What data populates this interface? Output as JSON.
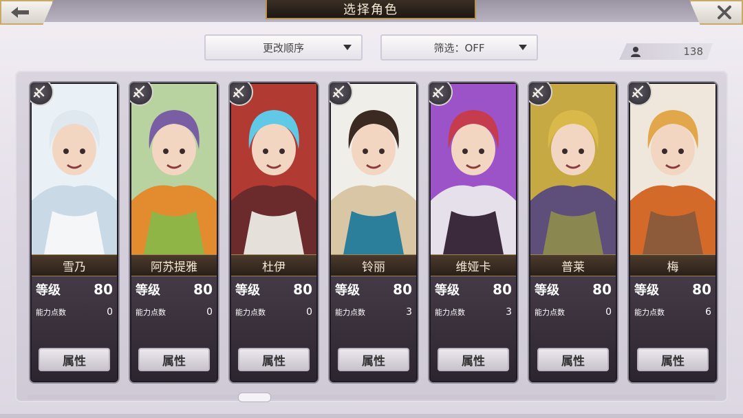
{
  "header": {
    "title": "选择角色",
    "back_icon": "back-arrow-icon",
    "close_icon": "close-icon"
  },
  "controls": {
    "sort_label": "更改顺序",
    "filter_label": "筛选：OFF",
    "roster_count": "138"
  },
  "labels": {
    "level": "等级",
    "ability_points": "能力点数",
    "attributes_button": "属性"
  },
  "characters": [
    {
      "name": "雪乃",
      "level": "80",
      "ability_points": "0",
      "colors": [
        "#e9f1f7",
        "#c9d9e6",
        "#f4f6f8"
      ],
      "hair": "#dfe7ef"
    },
    {
      "name": "阿苏提雅",
      "level": "80",
      "ability_points": "0",
      "colors": [
        "#b8d2a0",
        "#e28b2f",
        "#8fb547"
      ],
      "hair": "#7a5ea3"
    },
    {
      "name": "杜伊",
      "level": "80",
      "ability_points": "0",
      "colors": [
        "#b13a33",
        "#6b2a2b",
        "#e6e0da"
      ],
      "hair": "#5fc9e6"
    },
    {
      "name": "铃丽",
      "level": "80",
      "ability_points": "3",
      "colors": [
        "#f0eee9",
        "#d9c6a4",
        "#2b7f9b"
      ],
      "hair": "#3a2a22"
    },
    {
      "name": "维娅卡",
      "level": "80",
      "ability_points": "3",
      "colors": [
        "#9b53c7",
        "#e5e0ea",
        "#3a2a3c"
      ],
      "hair": "#c43c4e"
    },
    {
      "name": "普莱",
      "level": "80",
      "ability_points": "0",
      "colors": [
        "#c7a943",
        "#5d4e7a",
        "#8a8750"
      ],
      "hair": "#d9b94a"
    },
    {
      "name": "梅",
      "level": "80",
      "ability_points": "6",
      "colors": [
        "#efe6dc",
        "#d46a2a",
        "#8d5a3a"
      ],
      "hair": "#e2a64b"
    }
  ]
}
